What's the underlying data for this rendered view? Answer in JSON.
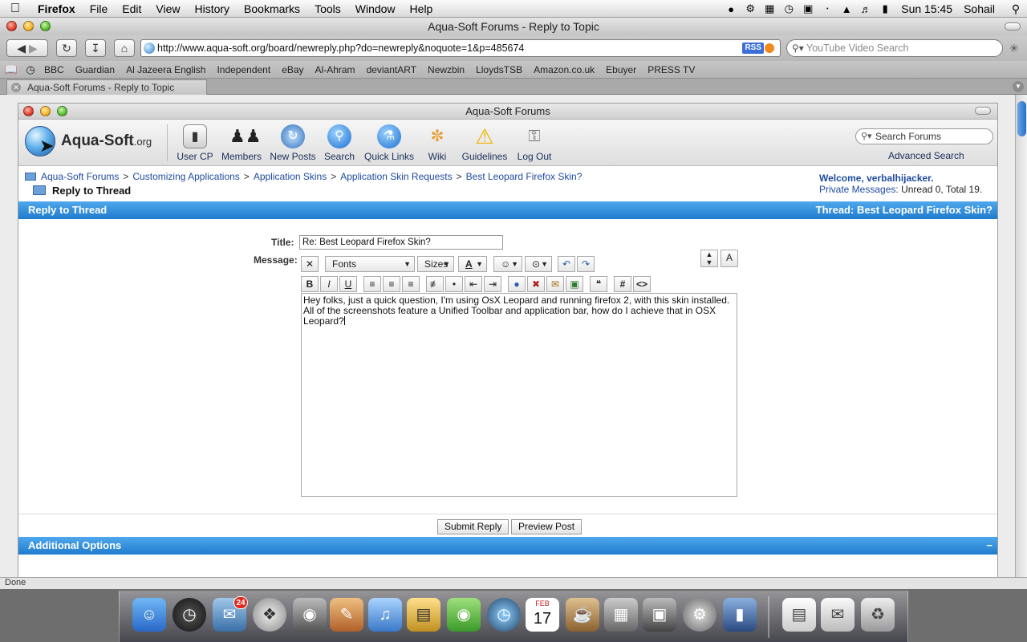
{
  "menubar": {
    "app_name": "Firefox",
    "menus": [
      "File",
      "Edit",
      "View",
      "History",
      "Bookmarks",
      "Tools",
      "Window",
      "Help"
    ],
    "clock": "Sun 15:45",
    "user": "Sohail"
  },
  "window": {
    "title": "Aqua-Soft Forums - Reply to Topic",
    "url": "http://www.aqua-soft.org/board/newreply.php?do=newreply&noquote=1&p=485674",
    "rss_label": "RSS",
    "search_placeholder": "YouTube Video Search",
    "bookmarks": [
      "BBC",
      "Guardian",
      "Al Jazeera English",
      "Independent",
      "eBay",
      "Al-Ahram",
      "deviantART",
      "Newzbin",
      "LloydsTSB",
      "Amazon.co.uk",
      "Ebuyer",
      "PRESS TV"
    ],
    "tab_title": "Aqua-Soft Forums - Reply to Topic",
    "status": "Done"
  },
  "forum": {
    "window_title": "Aqua-Soft Forums",
    "logo_text": "Aqua-Soft",
    "logo_suffix": ".org",
    "nav": [
      {
        "label": "User CP"
      },
      {
        "label": "Members"
      },
      {
        "label": "New Posts"
      },
      {
        "label": "Search"
      },
      {
        "label": "Quick Links"
      },
      {
        "label": "Wiki"
      },
      {
        "label": "Guidelines"
      },
      {
        "label": "Log Out"
      }
    ],
    "search_placeholder": "Search Forums",
    "advanced_search": "Advanced Search",
    "breadcrumbs": [
      "Aqua-Soft Forums",
      "Customizing Applications",
      "Application Skins",
      "Application Skin Requests",
      "Best Leopard Firefox Skin?"
    ],
    "breadcrumb_sep": ">",
    "current_page": "Reply to Thread",
    "welcome": "Welcome, verbalhijacker.",
    "pm_label": "Private Messages:",
    "pm_value": "Unread 0, Total 19.",
    "reply_bar_left": "Reply to Thread",
    "reply_bar_right_label": "Thread:",
    "reply_bar_right_value": "Best Leopard Firefox Skin?",
    "title_label": "Title:",
    "title_value": "Re: Best Leopard Firefox Skin?",
    "message_label": "Message:",
    "fonts_label": "Fonts",
    "sizes_label": "Sizes",
    "message_text": "Hey folks, just a quick question, I'm using OsX Leopard and running firefox 2, with this skin installed. All of the screenshots feature a Unified Toolbar and application bar, how do I achieve that in OSX Leopard?",
    "submit_label": "Submit Reply",
    "preview_label": "Preview Post",
    "additional_options": "Additional Options",
    "collapse_glyph": "−"
  },
  "dock": {
    "mail_badge": "24",
    "calendar_month": "FEB",
    "calendar_day": "17"
  }
}
